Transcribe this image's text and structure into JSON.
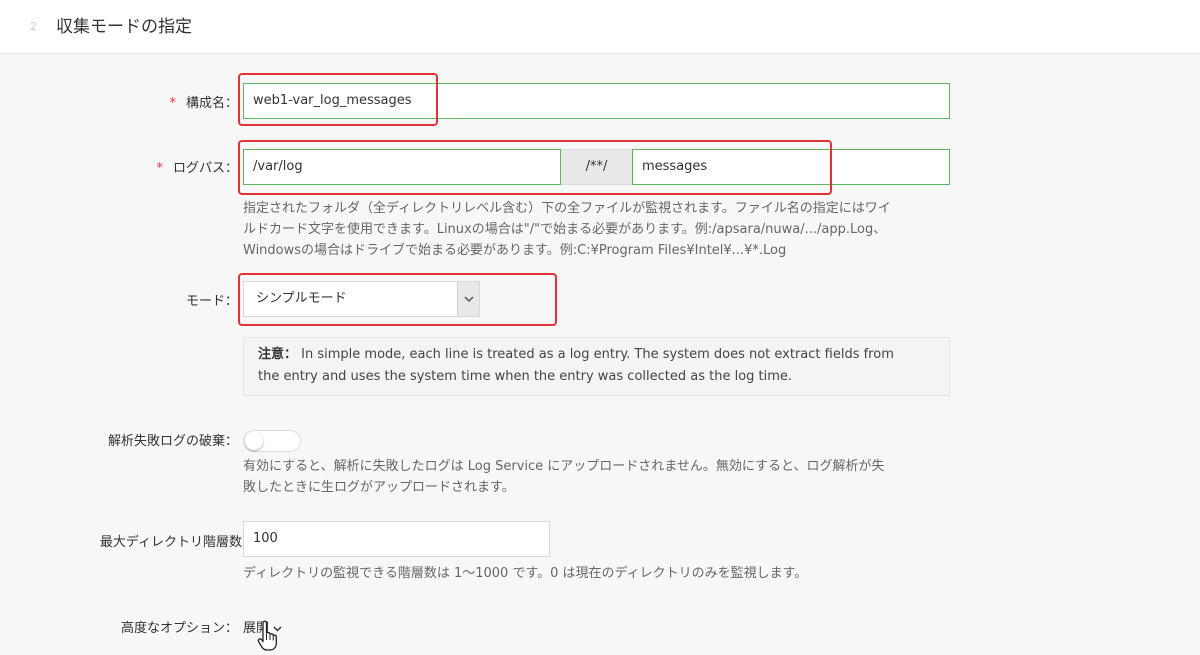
{
  "header": {
    "title": "収集モードの指定"
  },
  "config_name": {
    "label": "構成名：",
    "required_mark": "*",
    "value": "web1-var_log_messages"
  },
  "log_path": {
    "label": "ログパス：",
    "required_mark": "*",
    "directory": "/var/log",
    "separator": "/**/",
    "file_name": "messages",
    "help_lines": [
      "指定されたフォルダ（全ディレクトリレベル含む）下の全ファイルが監視されます。ファイル名の指定にはワイ",
      "ルドカード文字を使用できます。Linuxの場合は\"/\"で始まる必要があります。例:/apsara/nuwa/.../app.Log、",
      "Windowsの場合はドライブで始まる必要があります。例:C:¥Program Files¥Intel¥...¥*.Log"
    ]
  },
  "mode": {
    "label": "モード：",
    "selected": "シンプルモード",
    "note_title": "注意：",
    "note_lines": [
      "In simple mode, each line is treated as a log entry. The system does not extract fields from",
      "the entry and uses the system time when the entry was collected as the log time."
    ]
  },
  "discard_failed": {
    "label": "解析失敗ログの破棄：",
    "enabled": false,
    "help_lines": [
      "有効にすると、解析に失敗したログは Log Service にアップロードされません。無効にすると、ログ解析が失",
      "敗したときに生ログがアップロードされます。"
    ]
  },
  "max_depth": {
    "label": "最大ディレクトリ階層数",
    "value": "100",
    "help": "ディレクトリの監視できる階層数は 1～1000 です。0 は現在のディレクトリのみを監視します。"
  },
  "advanced": {
    "label": "高度なオプション：",
    "expand_label": "展開"
  },
  "colors": {
    "required": "#e0343a",
    "valid_border": "#5ab75c",
    "highlight": "#e0343a"
  }
}
